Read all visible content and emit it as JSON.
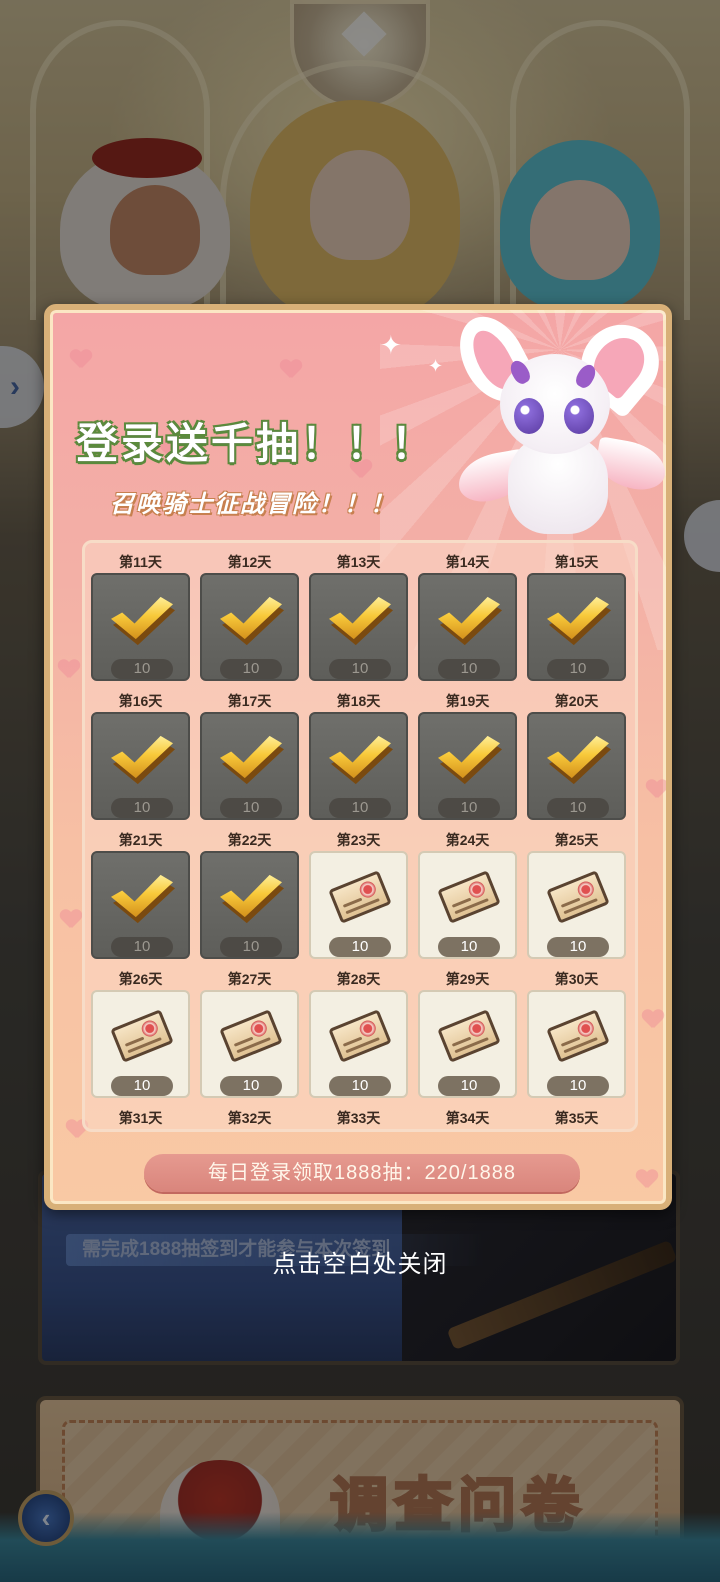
{
  "modal": {
    "title": "登录送千抽！！！",
    "subtitle": "召唤骑士征战冒险！！！",
    "progress_text": "每日登录领取1888抽：220/1888"
  },
  "days": [
    {
      "label": "第11天",
      "count": "10",
      "status": "claimed"
    },
    {
      "label": "第12天",
      "count": "10",
      "status": "claimed"
    },
    {
      "label": "第13天",
      "count": "10",
      "status": "claimed"
    },
    {
      "label": "第14天",
      "count": "10",
      "status": "claimed"
    },
    {
      "label": "第15天",
      "count": "10",
      "status": "claimed"
    },
    {
      "label": "第16天",
      "count": "10",
      "status": "claimed"
    },
    {
      "label": "第17天",
      "count": "10",
      "status": "claimed"
    },
    {
      "label": "第18天",
      "count": "10",
      "status": "claimed"
    },
    {
      "label": "第19天",
      "count": "10",
      "status": "claimed"
    },
    {
      "label": "第20天",
      "count": "10",
      "status": "claimed"
    },
    {
      "label": "第21天",
      "count": "10",
      "status": "claimed"
    },
    {
      "label": "第22天",
      "count": "10",
      "status": "claimed"
    },
    {
      "label": "第23天",
      "count": "10",
      "status": "pending"
    },
    {
      "label": "第24天",
      "count": "10",
      "status": "pending"
    },
    {
      "label": "第25天",
      "count": "10",
      "status": "pending"
    },
    {
      "label": "第26天",
      "count": "10",
      "status": "pending"
    },
    {
      "label": "第27天",
      "count": "10",
      "status": "pending"
    },
    {
      "label": "第28天",
      "count": "10",
      "status": "pending"
    },
    {
      "label": "第29天",
      "count": "10",
      "status": "pending"
    },
    {
      "label": "第30天",
      "count": "10",
      "status": "pending"
    }
  ],
  "partial_days": [
    "第31天",
    "第32天",
    "第33天",
    "第34天",
    "第35天"
  ],
  "close_hint": "点击空白处关闭",
  "background": {
    "banner_text": "需完成1888抽签到才能参与本次签到",
    "survey_title": "调查问卷"
  },
  "icons": {
    "claimed": "gold-check-icon",
    "pending": "summon-ticket-icon",
    "side_nav": "chevron-right-icon",
    "back": "chevron-left-icon"
  },
  "colors": {
    "modal_bg": "#f4a6a6",
    "modal_border": "#d8b078",
    "title_outline": "#5b8a3c",
    "claimed_card": "#6f6f6b",
    "pending_card": "#f3efe2"
  }
}
